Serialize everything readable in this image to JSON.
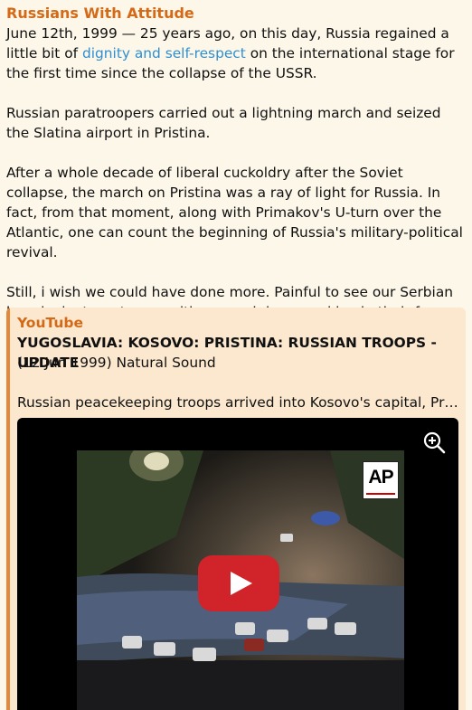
{
  "message": {
    "author": "Russians With Attitude",
    "p1_before": "June 12th, 1999 — 25 years ago, on this day, Russia regained a little bit of ",
    "p1_link": "dignity and self-respect",
    "p1_after": " on the international stage for the first time since the collapse of the USSR.",
    "p2": "Russian paratroopers carried out a lightning march and seized the Slatina airport in Pristina.",
    "p3": "After a whole decade of liberal cuckoldry after the Soviet collapse, the march on Pristina was a ray of light for Russia. In fact, from that moment, along with Primakov's U-turn over the Atlantic, one can count the beginning of Russia's military-political revival.",
    "p4": "Still, i wish we could have done more. Painful to see our Serbian bros look at our troops with so much hope and joy in their faces."
  },
  "preview": {
    "site": "YouTube",
    "title": "YUGOSLAVIA: KOSOVO: PRISTINA: RUSSIAN TROOPS - UPDATE",
    "date_line": "(12 Jun 1999) Natural Sound",
    "description": "Russian peacekeeping troops arrived into Kosovo's capital, Pristina, to a rapturous welcome from Serbs",
    "watermark": "AP"
  },
  "colors": {
    "accent": "#d46a18",
    "link": "#2f8fd0",
    "background": "#fdf7ea",
    "preview_bg": "#fbe8cf",
    "play_button": "#d1242a"
  },
  "icons": [
    "zoom-in-icon",
    "play-icon"
  ]
}
